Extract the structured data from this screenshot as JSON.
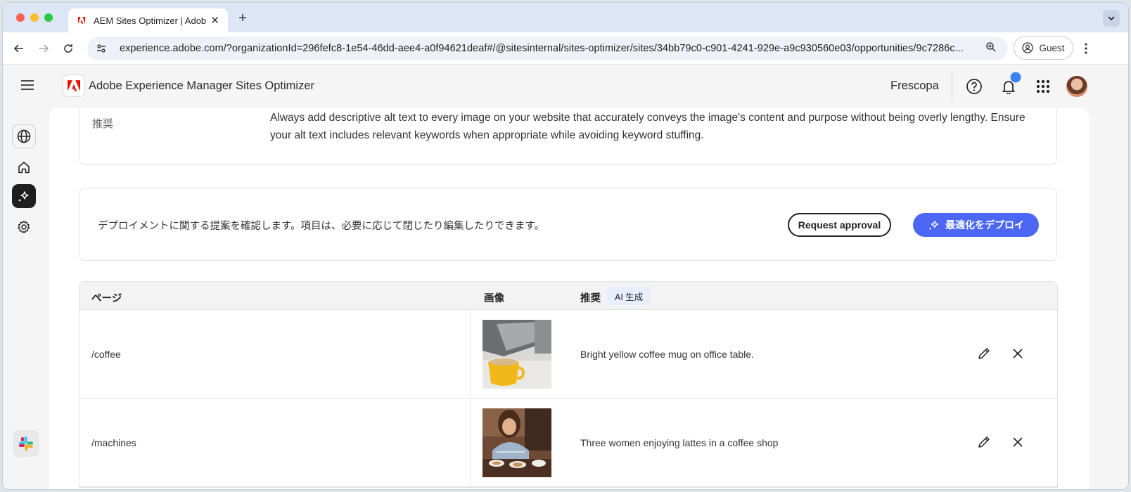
{
  "browser": {
    "tab_title": "AEM Sites Optimizer | Adobe",
    "url": "experience.adobe.com/?organizationId=296fefc8-1e54-46dd-aee4-a0f94621deaf#/@sitesinternal/sites-optimizer/sites/34bb79c0-c901-4241-929e-a9c930560e03/opportunities/9c7286c...",
    "profile_label": "Guest"
  },
  "header": {
    "app_name": "Adobe Experience Manager Sites Optimizer",
    "org_name": "Frescopa"
  },
  "recommendation": {
    "label": "推奨",
    "text": "Always add descriptive alt text to every image on your website that accurately conveys the image's content and purpose without being overly lengthy. Ensure your alt text includes relevant keywords when appropriate while avoiding keyword stuffing."
  },
  "deploy": {
    "description": "デプロイメントに関する提案を確認します。項目は、必要に応じて閉じたり編集したりできます。",
    "request_approval_label": "Request approval",
    "deploy_label": "最適化をデプロイ"
  },
  "table": {
    "headers": {
      "page": "ページ",
      "image": "画像",
      "suggestion": "推奨",
      "ai_badge": "AI 生成"
    },
    "rows": [
      {
        "page": "/coffee",
        "suggestion": "Bright yellow coffee mug on office table."
      },
      {
        "page": "/machines",
        "suggestion": "Three women enjoying lattes in a coffee shop"
      }
    ]
  },
  "colors": {
    "accent": "#4b67f3",
    "adobe_red": "#eb1000",
    "notification_dot": "#3b82f6"
  }
}
